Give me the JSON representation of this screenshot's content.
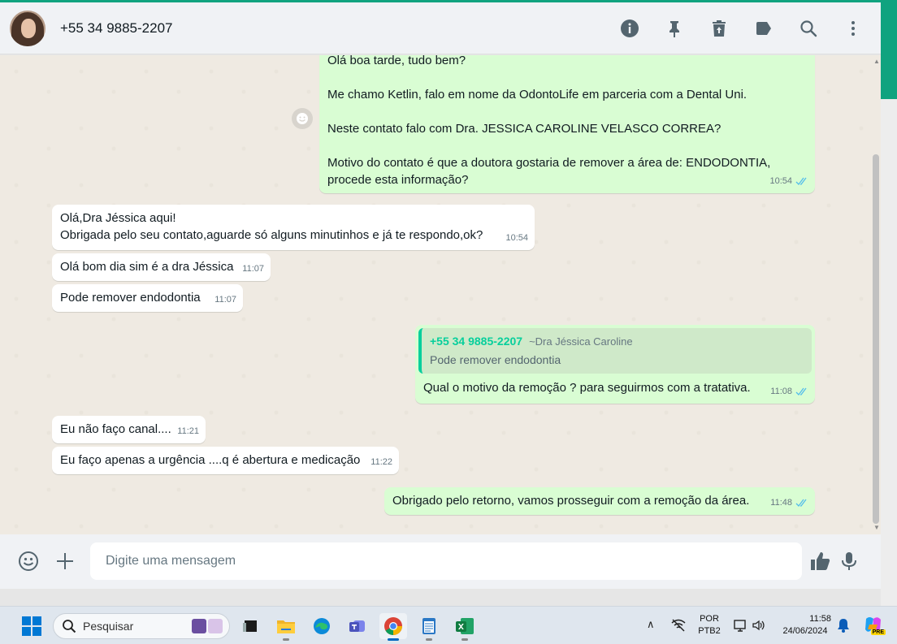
{
  "header": {
    "contact_name": "+55 34 9885-2207",
    "icons": [
      "info-icon",
      "pin-icon",
      "delete-icon",
      "label-icon",
      "search-icon",
      "menu-icon"
    ]
  },
  "messages": [
    {
      "direction": "outgoing",
      "text": "Olá boa tarde, tudo bem?\n\nMe chamo Ketlin, falo em nome da OdontoLife em parceria com a Dental Uni.\n\nNeste contato falo com Dra. JESSICA CAROLINE VELASCO CORREA?\n\nMotivo do contato é que a doutora gostaria de remover a área de: ENDODONTIA,\nprocede esta informação?",
      "time": "10:54",
      "status": "read"
    },
    {
      "direction": "incoming",
      "text": "Olá,Dra Jéssica aqui!\nObrigada pelo seu contato,aguarde só alguns minutinhos e já te respondo,ok?",
      "time": "10:54"
    },
    {
      "direction": "incoming",
      "text": "Olá bom dia sim é a dra Jéssica",
      "time": "11:07"
    },
    {
      "direction": "incoming",
      "text": "Pode remover endodontia",
      "time": "11:07"
    },
    {
      "direction": "outgoing",
      "quote": {
        "author": "+55 34 9885-2207",
        "alias": "~Dra Jéssica Caroline",
        "text": "Pode remover endodontia"
      },
      "text": "Qual o motivo da remoção ? para seguirmos com a tratativa.",
      "time": "11:08",
      "status": "read"
    },
    {
      "direction": "incoming",
      "text": "Eu não faço canal....",
      "time": "11:21"
    },
    {
      "direction": "incoming",
      "text": "Eu faço apenas a urgência ....q é abertura e medicação",
      "time": "11:22"
    },
    {
      "direction": "outgoing",
      "text": "Obrigado pelo retorno, vamos prosseguir com a remoção da área.",
      "time": "11:48",
      "status": "read"
    }
  ],
  "composer": {
    "placeholder": "Digite uma mensagem"
  },
  "taskbar": {
    "search_label": "Pesquisar",
    "language_line1": "POR",
    "language_line2": "PTB2",
    "time": "11:58",
    "date": "24/06/2024",
    "copilot_badge": "PRE"
  },
  "colors": {
    "outgoing_bubble": "#d9fdd3",
    "incoming_bubble": "#ffffff",
    "chat_background": "#efeae2",
    "accent": "#06cf9c",
    "read_ticks": "#53bdeb"
  }
}
